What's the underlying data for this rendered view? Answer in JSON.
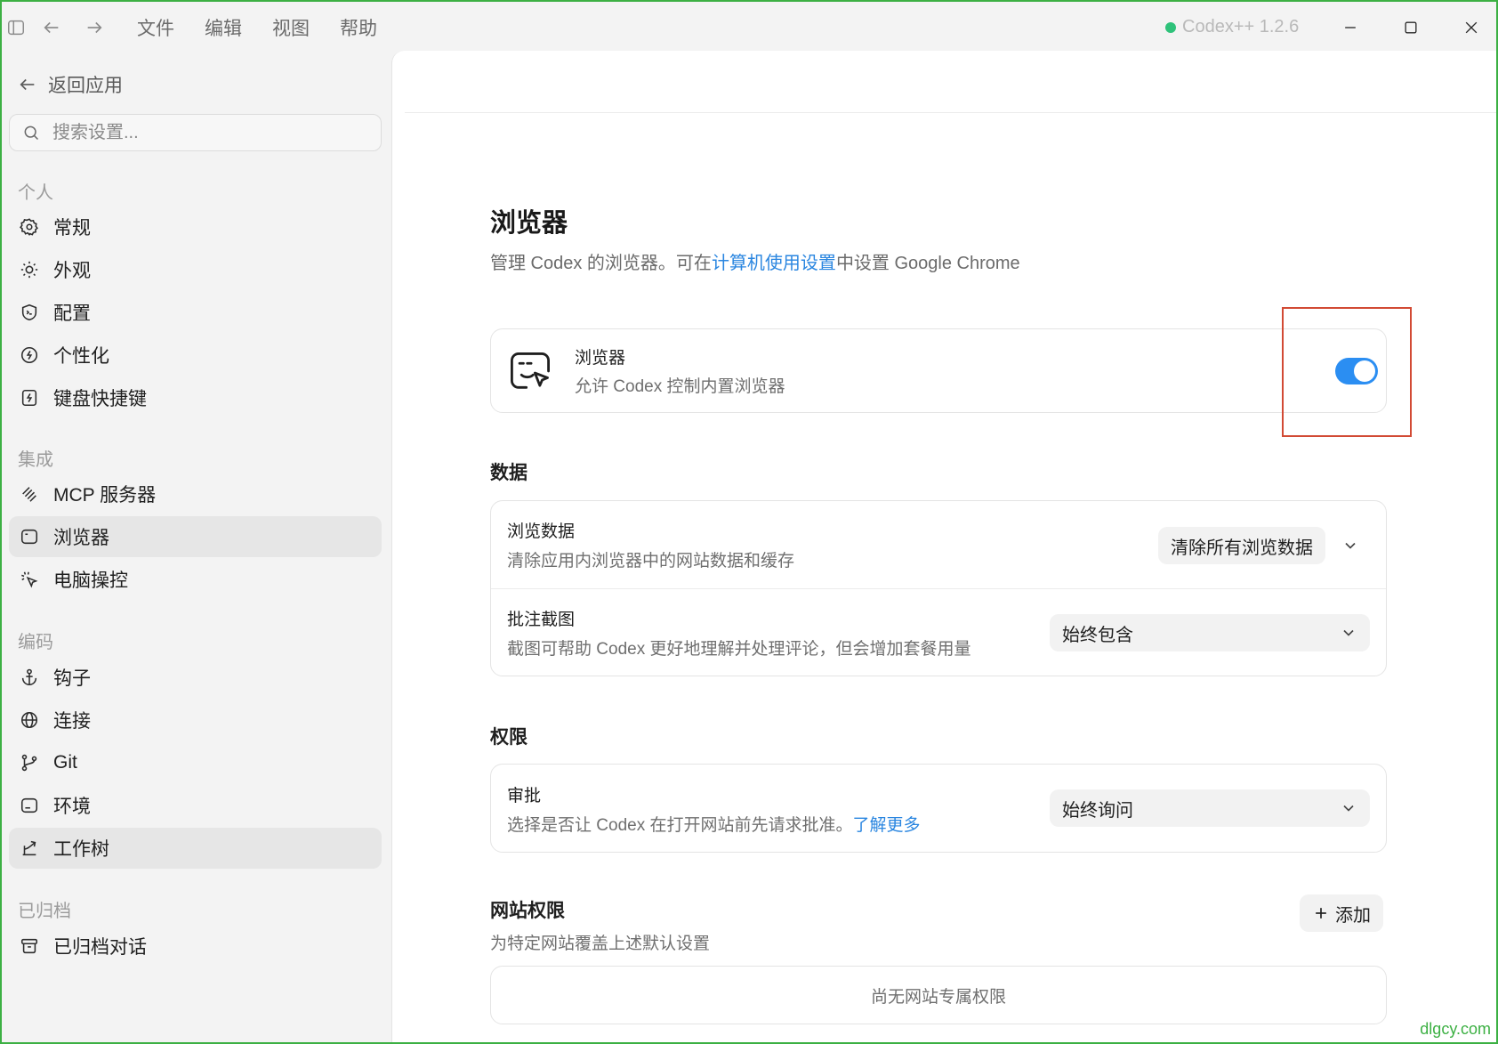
{
  "titlebar": {
    "menu": [
      "文件",
      "编辑",
      "视图",
      "帮助"
    ],
    "app_version": "Codex++ 1.2.6",
    "status_color": "#2fc27a"
  },
  "sidebar": {
    "back_label": "返回应用",
    "search_placeholder": "搜索设置...",
    "sections": {
      "personal": "个人",
      "integration": "集成",
      "coding": "编码",
      "archived": "已归档"
    },
    "items": {
      "general": "常规",
      "appearance": "外观",
      "config": "配置",
      "personalize": "个性化",
      "shortcuts": "键盘快捷键",
      "mcp": "MCP 服务器",
      "browser": "浏览器",
      "computer_use": "电脑操控",
      "hooks": "钩子",
      "connections": "连接",
      "git": "Git",
      "environment": "环境",
      "worktree": "工作树",
      "archived_chats": "已归档对话"
    }
  },
  "main": {
    "title": "浏览器",
    "desc_prefix": "管理 Codex 的浏览器。可在",
    "desc_link": "计算机使用设置",
    "desc_suffix": "中设置 Google Chrome",
    "browser_card": {
      "title": "浏览器",
      "subtitle": "允许 Codex 控制内置浏览器",
      "enabled": true
    },
    "data_section": {
      "heading": "数据",
      "browse_data_title": "浏览数据",
      "browse_data_sub": "清除应用内浏览器中的网站数据和缓存",
      "clear_button": "清除所有浏览数据",
      "screenshot_title": "批注截图",
      "screenshot_sub": "截图可帮助 Codex 更好地理解并处理评论，但会增加套餐用量",
      "screenshot_value": "始终包含"
    },
    "permissions_section": {
      "heading": "权限",
      "approval_title": "审批",
      "approval_sub": "选择是否让 Codex 在打开网站前先请求批准。",
      "approval_link": "了解更多",
      "approval_value": "始终询问"
    },
    "site_permissions": {
      "heading": "网站权限",
      "sub": "为特定网站覆盖上述默认设置",
      "add_button": "添加",
      "empty": "尚无网站专属权限"
    }
  },
  "watermark": "dlgcy.com",
  "colors": {
    "accent": "#2b8ef2",
    "link": "#2a86e0",
    "highlight": "#d24a34",
    "frame": "#3cb043"
  }
}
